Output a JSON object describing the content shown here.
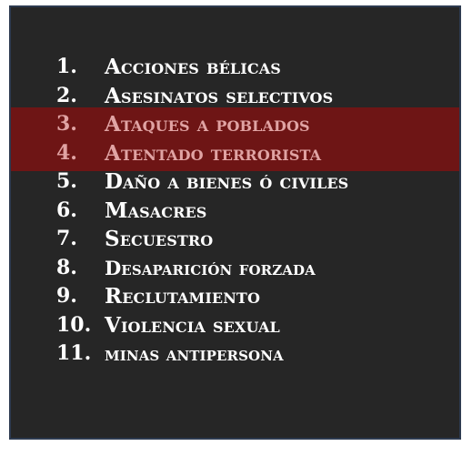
{
  "list": {
    "items": [
      {
        "number": "1.",
        "label": "Acciones bélicas",
        "highlighted": false
      },
      {
        "number": "2.",
        "label": "Asesinatos selectivos",
        "highlighted": false
      },
      {
        "number": "3.",
        "label": "Ataques a poblados",
        "highlighted": true
      },
      {
        "number": "4.",
        "label": "Atentado terrorista",
        "highlighted": true
      },
      {
        "number": "5.",
        "label": "Daño a bienes ó civiles",
        "highlighted": false
      },
      {
        "number": "6.",
        "label": "Masacres",
        "highlighted": false
      },
      {
        "number": "7.",
        "label": "Secuestro",
        "highlighted": false
      },
      {
        "number": "8.",
        "label": "Desaparición forzada",
        "highlighted": false
      },
      {
        "number": "9.",
        "label": "Reclutamiento",
        "highlighted": false
      },
      {
        "number": "10.",
        "label": "Violencia sexual",
        "highlighted": false
      },
      {
        "number": "11.",
        "label": "minas antipersona",
        "highlighted": false
      }
    ]
  },
  "colors": {
    "background": "#262626",
    "border": "#2d3a4f",
    "highlight_band": "#6e1515",
    "highlight_text": "#e0a3a3",
    "text": "#ffffff"
  }
}
